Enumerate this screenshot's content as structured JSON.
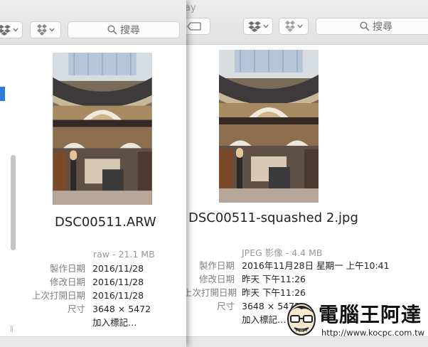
{
  "back_window": {
    "title_fragment": "ay",
    "search_placeholder": "搜尋",
    "filename": "DSC00511-squashed 2.jpg",
    "kind_size": "JPEG 影像 - 4.4 MB",
    "metadata": [
      {
        "label": "製作日期",
        "value": "2016年11月28日 星期一 上午10:41"
      },
      {
        "label": "修改日期",
        "value": "昨天 下午11:26"
      },
      {
        "label": "上次打開日期",
        "value": "昨天 下午11:26"
      },
      {
        "label": "尺寸",
        "value": "3648 × 5472"
      }
    ],
    "add_tags": "加入標記…"
  },
  "front_window": {
    "search_placeholder": "搜尋",
    "filename": "DSC00511.ARW",
    "kind_size": "raw - 21.1 MB",
    "metadata": [
      {
        "label": "製作日期",
        "value": "2016/11/28"
      },
      {
        "label": "修改日期",
        "value": "2016/11/28"
      },
      {
        "label": "上次打開日期",
        "value": "2016/11/28"
      },
      {
        "label": "尺寸",
        "value": "3648 × 5472"
      }
    ],
    "add_tags": "加入標記…"
  },
  "watermark": {
    "title": "電腦王阿達",
    "url": "http://www.kocpc.com.tw"
  },
  "icons": {
    "dropbox": "dropbox-icon",
    "dropbox_gray": "dropbox-gray-icon",
    "search": "search-icon",
    "tag": "tag-icon",
    "chevron": "chevron-down-icon"
  },
  "colors": {
    "accent": "#2c7cd8",
    "link": "#3c83d6"
  }
}
